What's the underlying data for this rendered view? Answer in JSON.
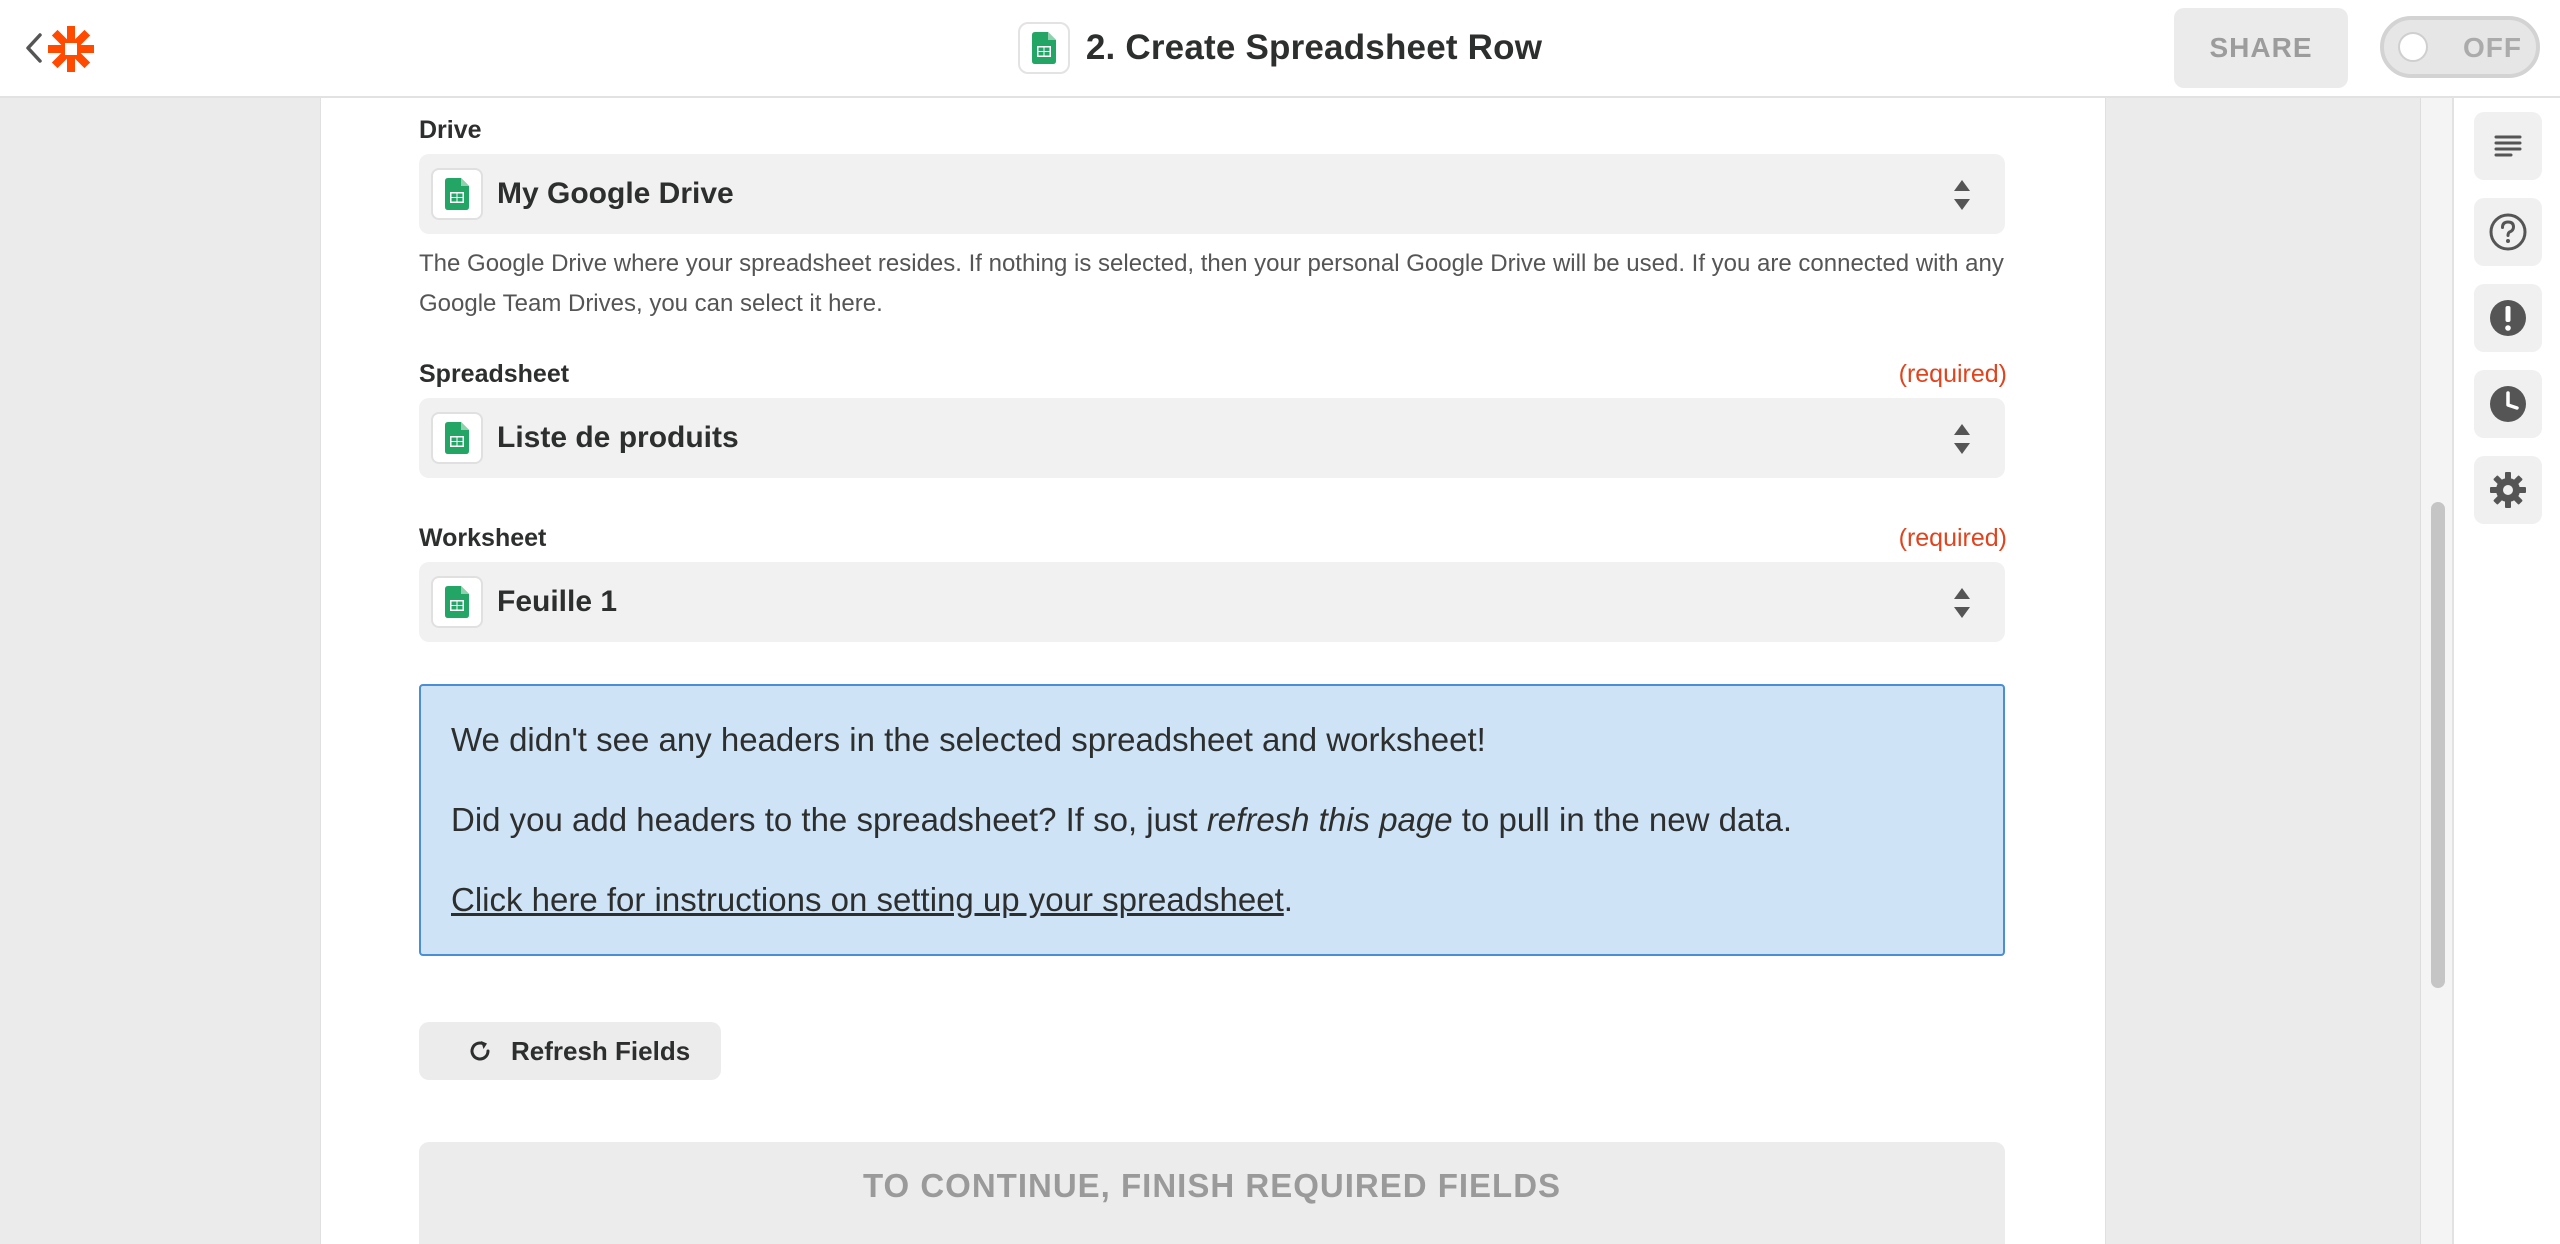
{
  "header": {
    "title": "2. Create Spreadsheet Row",
    "share_label": "SHARE",
    "toggle_label": "OFF",
    "app_icon": "google-sheets-icon",
    "logo": "zapier-logo"
  },
  "form": {
    "drive": {
      "label": "Drive",
      "value": "My Google Drive",
      "help": "The Google Drive where your spreadsheet resides. If nothing is selected, then your personal Google Drive will be used. If you are connected with any Google Team Drives, you can select it here."
    },
    "spreadsheet": {
      "label": "Spreadsheet",
      "required": "(required)",
      "value": "Liste de produits"
    },
    "worksheet": {
      "label": "Worksheet",
      "required": "(required)",
      "value": "Feuille 1"
    }
  },
  "notice": {
    "line1": "We didn't see any headers in the selected spreadsheet and worksheet!",
    "line2_before": "Did you add headers to the spreadsheet? If so, just ",
    "line2_em": "refresh this page",
    "line2_after": " to pull in the new data.",
    "link": "Click here for instructions on setting up your spreadsheet",
    "link_after": "."
  },
  "buttons": {
    "refresh": "Refresh Fields",
    "continue": "TO CONTINUE, FINISH REQUIRED FIELDS"
  },
  "rail": {
    "items": [
      "details-icon",
      "help-icon",
      "alert-icon",
      "history-icon",
      "settings-icon"
    ]
  },
  "colors": {
    "accent": "#ff4a00",
    "required": "#e0441f",
    "notice_bg": "#cfe3f7",
    "notice_border": "#4a8fd6",
    "sheets_green": "#23a566"
  }
}
